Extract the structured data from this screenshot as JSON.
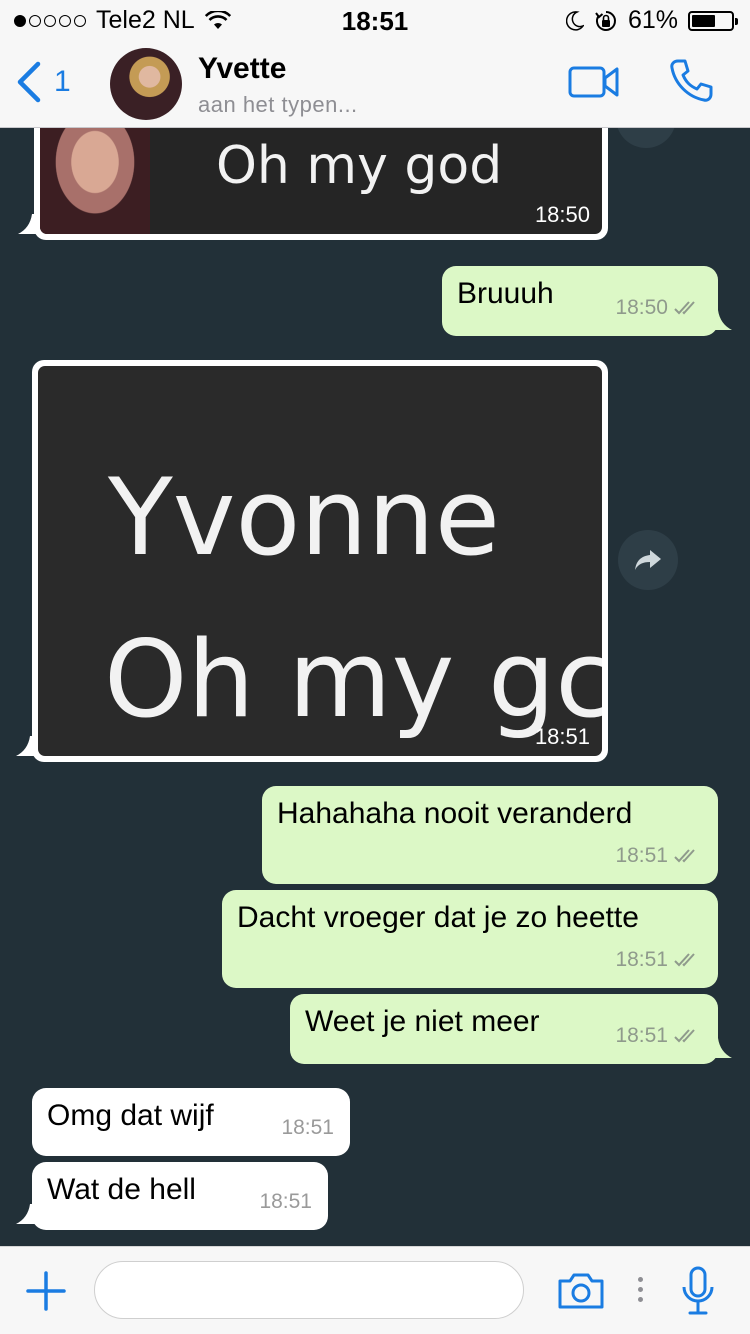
{
  "status_bar": {
    "carrier": "Tele2 NL",
    "signal_bars": 1,
    "time": "18:51",
    "battery_percent": "61%",
    "battery_level": 0.61
  },
  "header": {
    "back_count": "1",
    "contact_name": "Yvette",
    "contact_status": "aan het typen...",
    "accent_color": "#1a7ce2"
  },
  "messages": [
    {
      "type": "image",
      "direction": "in",
      "image_text": [
        "Oh my god"
      ],
      "time": "18:50"
    },
    {
      "type": "text",
      "direction": "out",
      "text": "Bruuuh",
      "time": "18:50",
      "read": true
    },
    {
      "type": "image",
      "direction": "in",
      "image_text": [
        "Yvonne",
        "Oh my gc"
      ],
      "time": "18:51"
    },
    {
      "type": "text",
      "direction": "out",
      "text": "Hahahaha nooit veranderd",
      "time": "18:51",
      "read": true
    },
    {
      "type": "text",
      "direction": "out",
      "text": "Dacht vroeger dat je zo heette",
      "time": "18:51",
      "read": true
    },
    {
      "type": "text",
      "direction": "out",
      "text": "Weet je niet meer",
      "time": "18:51",
      "read": true
    },
    {
      "type": "text",
      "direction": "in",
      "text": "Omg dat wijf",
      "time": "18:51"
    },
    {
      "type": "text",
      "direction": "in",
      "text": "Wat de hell",
      "time": "18:51"
    }
  ],
  "input_bar": {
    "text_value": "",
    "placeholder": ""
  },
  "colors": {
    "chat_background": "#223038",
    "outgoing_bubble": "#dcf8c6",
    "incoming_bubble": "#ffffff"
  },
  "icons": {
    "back": "chevron-left-icon",
    "video": "video-camera-icon",
    "call": "phone-icon",
    "forward": "forward-arrow-icon",
    "add": "plus-icon",
    "camera": "camera-icon",
    "mic": "microphone-icon",
    "read_receipt": "double-check-icon"
  }
}
